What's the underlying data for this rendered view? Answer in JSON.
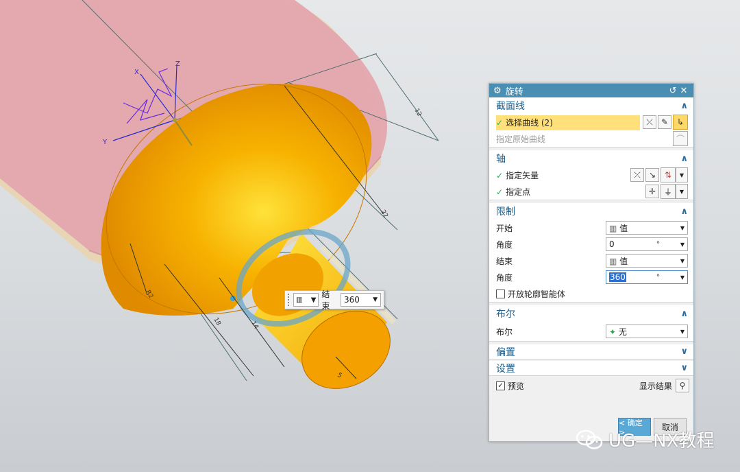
{
  "viewport": {
    "floating_tool": {
      "label": "结束",
      "value": "360",
      "type_icon": "value-type-icon"
    },
    "triad_labels": {
      "x": "X",
      "y": "Y",
      "z": "Z"
    },
    "dimension_labels": {
      "d1": "12",
      "d2": "22",
      "d3": "R2",
      "d4": "18",
      "d5": "14",
      "d6": "5"
    }
  },
  "dialog": {
    "title": "旋转",
    "sections": {
      "section_curve": {
        "title": "截面线",
        "select_curve": "选择曲线 (2)",
        "specify_origin_curve": "指定原始曲线"
      },
      "axis": {
        "title": "轴",
        "specify_vector": "指定矢量",
        "specify_point": "指定点"
      },
      "limits": {
        "title": "限制",
        "start_label": "开始",
        "start_type": "值",
        "start_angle_label": "角度",
        "start_angle": "0",
        "angle_unit": "°",
        "end_label": "结束",
        "end_type": "值",
        "end_angle_label": "角度",
        "end_angle": "360",
        "open_profile": "开放轮廓智能体"
      },
      "boolean": {
        "title": "布尔",
        "label": "布尔",
        "value": "无"
      },
      "offset": {
        "title": "偏置"
      },
      "settings": {
        "title": "设置"
      }
    },
    "preview_label": "预览",
    "show_result_label": "显示结果",
    "ok_label": "< 确定 >",
    "cancel_label": "取消"
  },
  "watermark": {
    "text": "UG—NX教程"
  },
  "colors": {
    "title_bar": "#4a8fb3",
    "highlight": "#ffe07a",
    "solid": "#f5a300",
    "plate": "#e4a7ae"
  }
}
